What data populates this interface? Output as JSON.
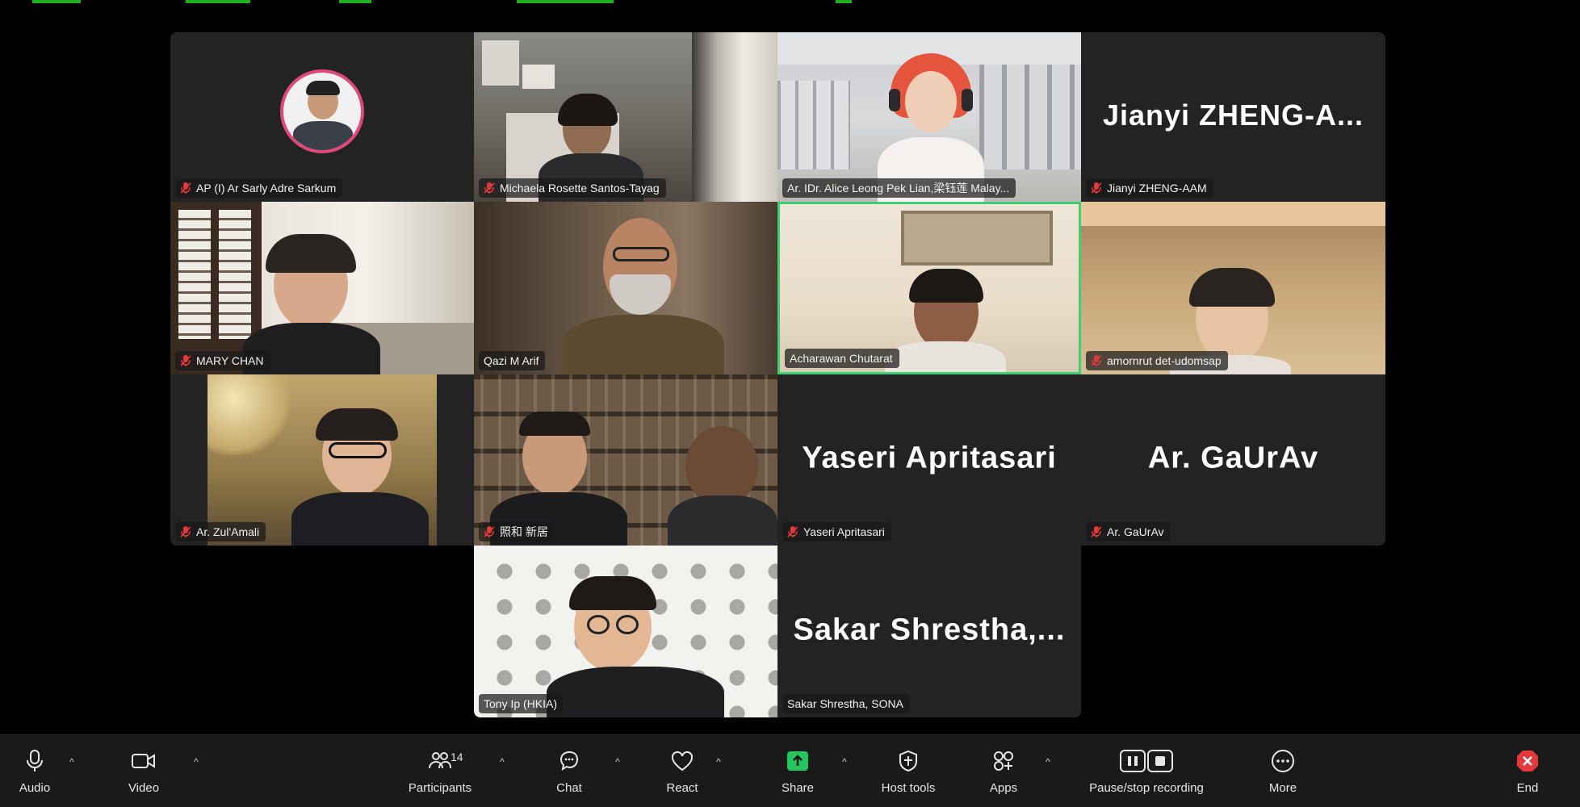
{
  "participants": [
    {
      "name": "AP (I) Ar Sarly Adre Sarkum",
      "muted": true
    },
    {
      "name": "Michaela Rosette Santos-Tayag",
      "muted": true
    },
    {
      "name": "Ar. IDr. Alice Leong Pek Lian,梁钰莲 Malay...",
      "muted": false
    },
    {
      "name": "Jianyi ZHENG-AAM",
      "muted": true,
      "display_name": "Jianyi  ZHENG-A..."
    },
    {
      "name": "MARY CHAN",
      "muted": true
    },
    {
      "name": "Qazi M Arif",
      "muted": false
    },
    {
      "name": "Acharawan Chutarat",
      "muted": false,
      "active_speaker": true
    },
    {
      "name": "amornrut det-udomsap",
      "muted": true
    },
    {
      "name": "Ar. Zul'Amali",
      "muted": true
    },
    {
      "name": "照和 新居",
      "muted": true
    },
    {
      "name": "Yaseri Apritasari",
      "muted": true,
      "display_name": "Yaseri Apritasari"
    },
    {
      "name": "Ar. GaUrAv",
      "muted": true,
      "display_name": "Ar. GaUrAv"
    },
    {
      "name": "Tony Ip (HKIA)",
      "muted": false
    },
    {
      "name": "Sakar Shrestha, SONA",
      "muted": false,
      "display_name": "Sakar  Shrestha,..."
    }
  ],
  "toolbar": {
    "audio": "Audio",
    "video": "Video",
    "participants": "Participants",
    "participants_count": "14",
    "chat": "Chat",
    "react": "React",
    "share": "Share",
    "host_tools": "Host tools",
    "apps": "Apps",
    "recording": "Pause/stop recording",
    "more": "More",
    "end": "End"
  },
  "icons": {
    "audio": "microphone-icon",
    "video": "video-camera-icon",
    "participants": "people-icon",
    "chat": "chat-bubble-icon",
    "react": "heart-icon",
    "share": "share-arrow-icon",
    "host_tools": "shield-icon",
    "apps": "apps-icon",
    "recording": "pause-stop-icon",
    "more": "ellipsis-icon",
    "end": "close-icon"
  },
  "colors": {
    "share_green": "#22c55e",
    "end_red": "#e5383b",
    "active_speaker": "#3ecf72",
    "muted_red": "#e5383b"
  }
}
